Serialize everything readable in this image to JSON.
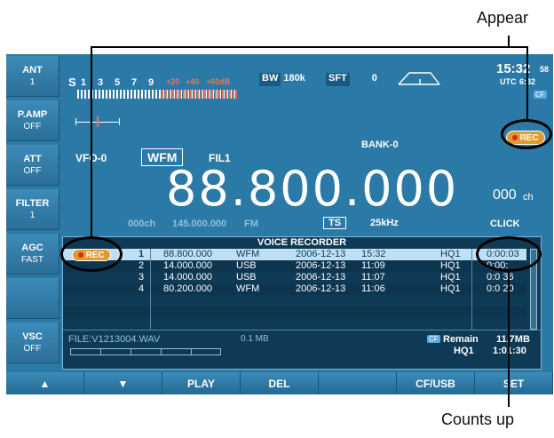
{
  "callouts": {
    "top": "Appear",
    "bottom": "Counts up"
  },
  "left_buttons": [
    {
      "label": "ANT",
      "value": "1"
    },
    {
      "label": "P.AMP",
      "value": "OFF"
    },
    {
      "label": "ATT",
      "value": "OFF"
    },
    {
      "label": "FILTER",
      "value": "1"
    },
    {
      "label": "AGC",
      "value": "FAST"
    },
    {
      "label": "",
      "value": ""
    },
    {
      "label": "VSC",
      "value": "OFF"
    }
  ],
  "s_meter": {
    "label": "S",
    "ticks": [
      "1",
      "3",
      "5",
      "7",
      "9"
    ],
    "over_ticks": [
      "+20",
      "+40",
      "+60dB"
    ]
  },
  "bw": {
    "label": "BW",
    "value": "180k"
  },
  "sft": {
    "label": "SFT",
    "value": "0"
  },
  "clock": {
    "time": "15:32",
    "seconds": "58",
    "utc_label": "UTC",
    "utc_time": "6:32",
    "cf": "CF"
  },
  "bank": "BANK-0",
  "rec_badge": "REC",
  "vfo": "VFO-0",
  "mode": "WFM",
  "filter": "FIL1",
  "frequency": "88.800.000",
  "channel": {
    "value": "000",
    "unit": "ch"
  },
  "sub_line": {
    "ch": "000ch",
    "freq": "145.000.000",
    "mode": "FM"
  },
  "ts": {
    "label": "TS",
    "value": "25kHz"
  },
  "click": "CLICK",
  "recorder": {
    "title": "VOICE RECORDER",
    "rows": [
      {
        "num": "1",
        "freq": "88.800.000",
        "mode": "WFM",
        "date": "2006-12-13",
        "time": "15:32",
        "quality": "HQ1",
        "len": "0:00:03"
      },
      {
        "num": "2",
        "freq": "14.000.000",
        "mode": "USB",
        "date": "2006-12-13",
        "time": "11:09",
        "quality": "HQ1",
        "len": "0:00:"
      },
      {
        "num": "3",
        "freq": "14.000.000",
        "mode": "USB",
        "date": "2006-12-13",
        "time": "11:07",
        "quality": "HQ1",
        "len": "0:0  36"
      },
      {
        "num": "4",
        "freq": "80.200.000",
        "mode": "WFM",
        "date": "2006-12-13",
        "time": "11:06",
        "quality": "HQ1",
        "len": "0:0  20"
      }
    ],
    "file": "FILE:V1213004.WAV",
    "size": "0.1 MB",
    "cf": "CF",
    "remain_label": "Remain",
    "remain_size": "11.7MB",
    "remain_q": "HQ1",
    "remain_time": "1:01:30"
  },
  "bottom_buttons": [
    "▲",
    "▼",
    "PLAY",
    "DEL",
    "",
    "CF/USB",
    "SET"
  ],
  "colors": {
    "screen": "#2b79a6",
    "highlight_row": "#bfe0f4",
    "rec": "#e09a2e"
  }
}
